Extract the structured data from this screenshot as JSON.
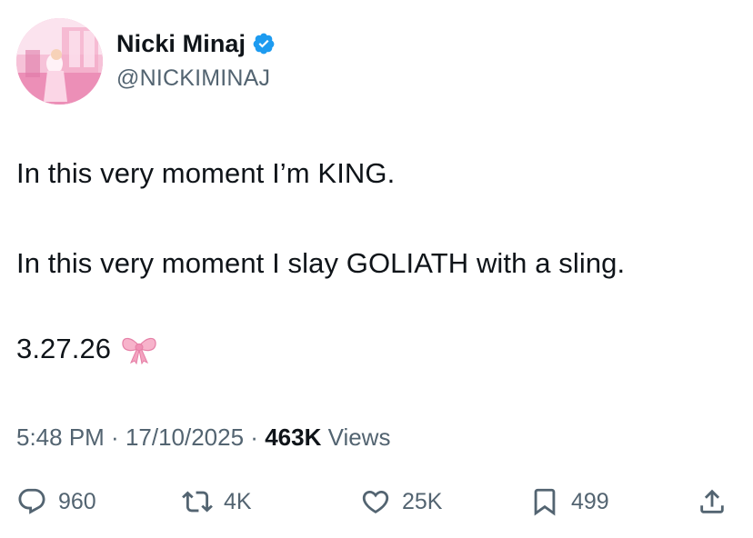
{
  "author": {
    "name": "Nicki Minaj",
    "handle": "@NICKIMINAJ",
    "verified": true,
    "verified_color": "#1d9bf0"
  },
  "tweet": {
    "line1": "In this very moment I’m KING.",
    "line2": "In this very moment I slay GOLIATH with a sling.",
    "line3": "3.27.26",
    "emoji": "ribbon-bow"
  },
  "meta": {
    "time": "5:48 PM",
    "sep1": " · ",
    "date": "17/10/2025",
    "sep2": " · ",
    "views_count": "463K",
    "views_label": " Views"
  },
  "actions": {
    "replies": "960",
    "reposts": "4K",
    "likes": "25K",
    "bookmarks": "499"
  },
  "colors": {
    "text": "#0f1419",
    "secondary": "#536471",
    "bow": "#f4a3c0"
  }
}
